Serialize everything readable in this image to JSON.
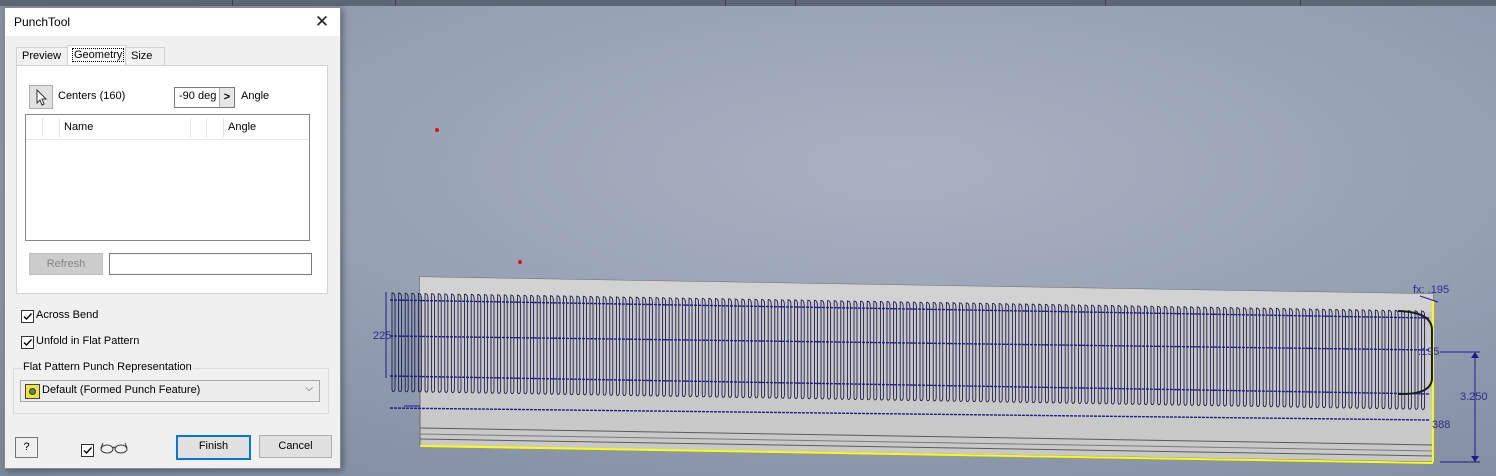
{
  "dialog": {
    "title": "PunchTool",
    "close_glyph": "✕",
    "tabs": [
      "Preview",
      "Geometry",
      "Size"
    ],
    "active_tab": "Geometry",
    "centers_label": "Centers (160)",
    "angle_value": "-90 deg",
    "angle_arrow": ">",
    "angle_label": "Angle",
    "table": {
      "columns": [
        "Name",
        "Angle"
      ],
      "rows": []
    },
    "refresh_label": "Refresh",
    "refresh_field_value": "",
    "across_bend": {
      "label": "Across Bend",
      "checked": true
    },
    "unfold_flat": {
      "label": "Unfold in Flat Pattern",
      "checked": true
    },
    "flat_rep_group": "Flat Pattern Punch Representation",
    "flat_rep_value": "Default (Formed Punch Feature)",
    "help_label": "?",
    "finish_label": "Finish",
    "cancel_label": "Cancel",
    "glasses_checked": true
  },
  "viewport": {
    "dim_fx": "fx: .195",
    "dim_height": "3.250",
    "dim_right_mid": ".195",
    "dim_bottom_right": "388",
    "dim_left": "225",
    "accent_dim_color": "#1c1c8c",
    "edge_highlight_color": "#ffff00"
  }
}
